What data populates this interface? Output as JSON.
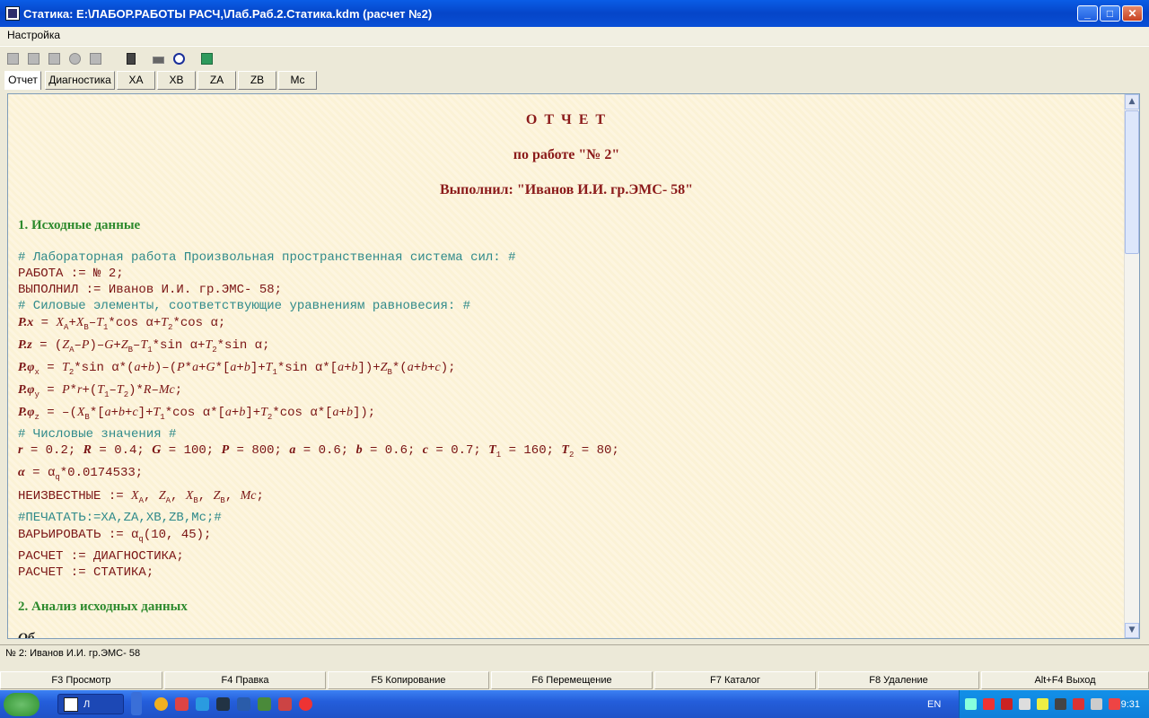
{
  "window": {
    "title": "Статика: E:\\ЛАБОР.РАБОТЫ РАСЧ,\\Лаб.Раб.2.Статика.kdm (расчет №2)"
  },
  "menu": {
    "items": [
      "Настройка"
    ]
  },
  "tabs": [
    "Отчет",
    "Диагностика",
    "XA",
    "XB",
    "ZA",
    "ZB",
    "Mc"
  ],
  "report": {
    "heading1": "О Т Ч Е Т",
    "heading2": "по работе \"№ 2\"",
    "heading3": "Выполнил: \"Иванов И.И. гр.ЭМС- 58\"",
    "section1": "1. Исходные данные",
    "section2": "2. Анализ исходных данных",
    "cut_text": "Об"
  },
  "status": {
    "text": "№ 2: Иванов И.И. гр.ЭМС- 58"
  },
  "fkeys": [
    "F3 Просмотр",
    "F4 Правка",
    "F5 Копирование",
    "F6 Перемещение",
    "F7 Каталог",
    "F8 Удаление",
    "Alt+F4 Выход"
  ],
  "taskbar": {
    "task_label": "Л",
    "lang": "EN",
    "clock": "9:31"
  }
}
